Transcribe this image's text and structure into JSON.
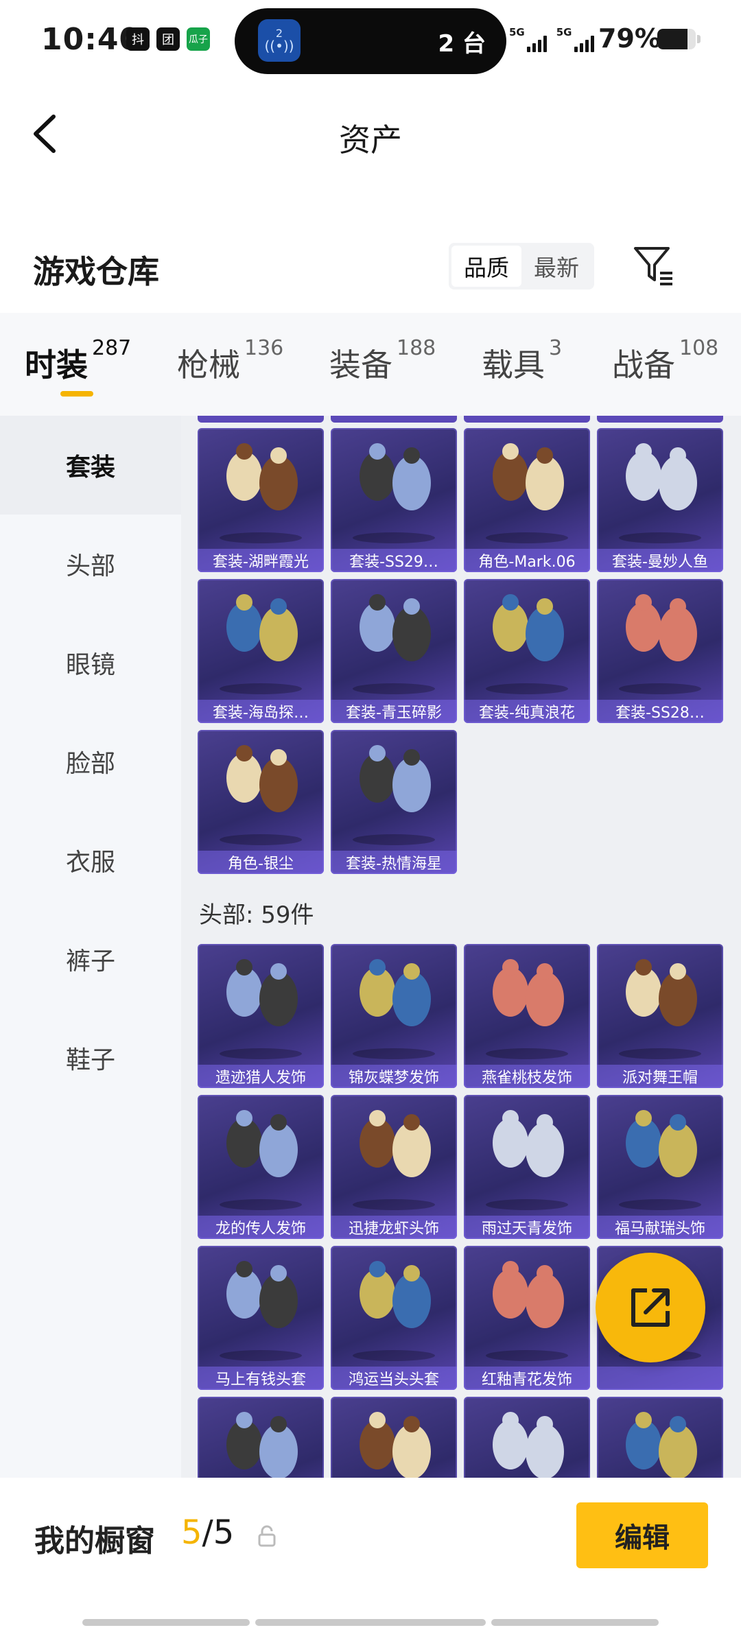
{
  "status_bar": {
    "time": "10:40",
    "apps": [
      "抖",
      "团",
      "瓜子"
    ],
    "island_icon_num": "2",
    "island_text": "2 台",
    "net1": "5G",
    "net2": "5G",
    "battery_text": "79%",
    "battery_level": 0.79
  },
  "header": {
    "title": "资产"
  },
  "section": {
    "title": "游戏仓库"
  },
  "sort": {
    "options": [
      "品质",
      "最新"
    ],
    "selected": "品质"
  },
  "tabs": [
    {
      "label": "时装",
      "count": "287",
      "active": true
    },
    {
      "label": "枪械",
      "count": "136"
    },
    {
      "label": "装备",
      "count": "188"
    },
    {
      "label": "载具",
      "count": "3"
    },
    {
      "label": "战备",
      "count": "108"
    }
  ],
  "sidebar": {
    "items": [
      {
        "label": "套装",
        "active": true
      },
      {
        "label": "头部"
      },
      {
        "label": "眼镜"
      },
      {
        "label": "脸部"
      },
      {
        "label": "衣服"
      },
      {
        "label": "裤子"
      },
      {
        "label": "鞋子"
      }
    ]
  },
  "suits": [
    {
      "label": "套装-湖畔霞光"
    },
    {
      "label": "套装-SS29…"
    },
    {
      "label": "角色-Mark.06"
    },
    {
      "label": "套装-曼妙人鱼"
    },
    {
      "label": "套装-海岛探…"
    },
    {
      "label": "套装-青玉碎影"
    },
    {
      "label": "套装-纯真浪花"
    },
    {
      "label": "套装-SS28…"
    },
    {
      "label": "角色-银尘"
    },
    {
      "label": "套装-热情海星"
    }
  ],
  "head_group": {
    "label": "头部: 59件"
  },
  "head_items": [
    {
      "label": "遗迹猎人发饰"
    },
    {
      "label": "锦灰蝶梦发饰"
    },
    {
      "label": "燕雀桃枝发饰"
    },
    {
      "label": "派对舞王帽"
    },
    {
      "label": "龙的传人发饰"
    },
    {
      "label": "迅捷龙虾头饰"
    },
    {
      "label": "雨过天青发饰"
    },
    {
      "label": "福马献瑞头饰"
    },
    {
      "label": "马上有钱头套"
    },
    {
      "label": "鸿运当头头套"
    },
    {
      "label": "红釉青花发饰"
    },
    {
      "label": ""
    },
    {
      "label": ""
    },
    {
      "label": ""
    },
    {
      "label": ""
    },
    {
      "label": ""
    }
  ],
  "showcase": {
    "title": "我的橱窗",
    "current": "5",
    "sep": "/",
    "total": "5"
  },
  "edit_label": "编辑",
  "colors": {
    "accent": "#f5b400",
    "card": "#3d3585"
  }
}
